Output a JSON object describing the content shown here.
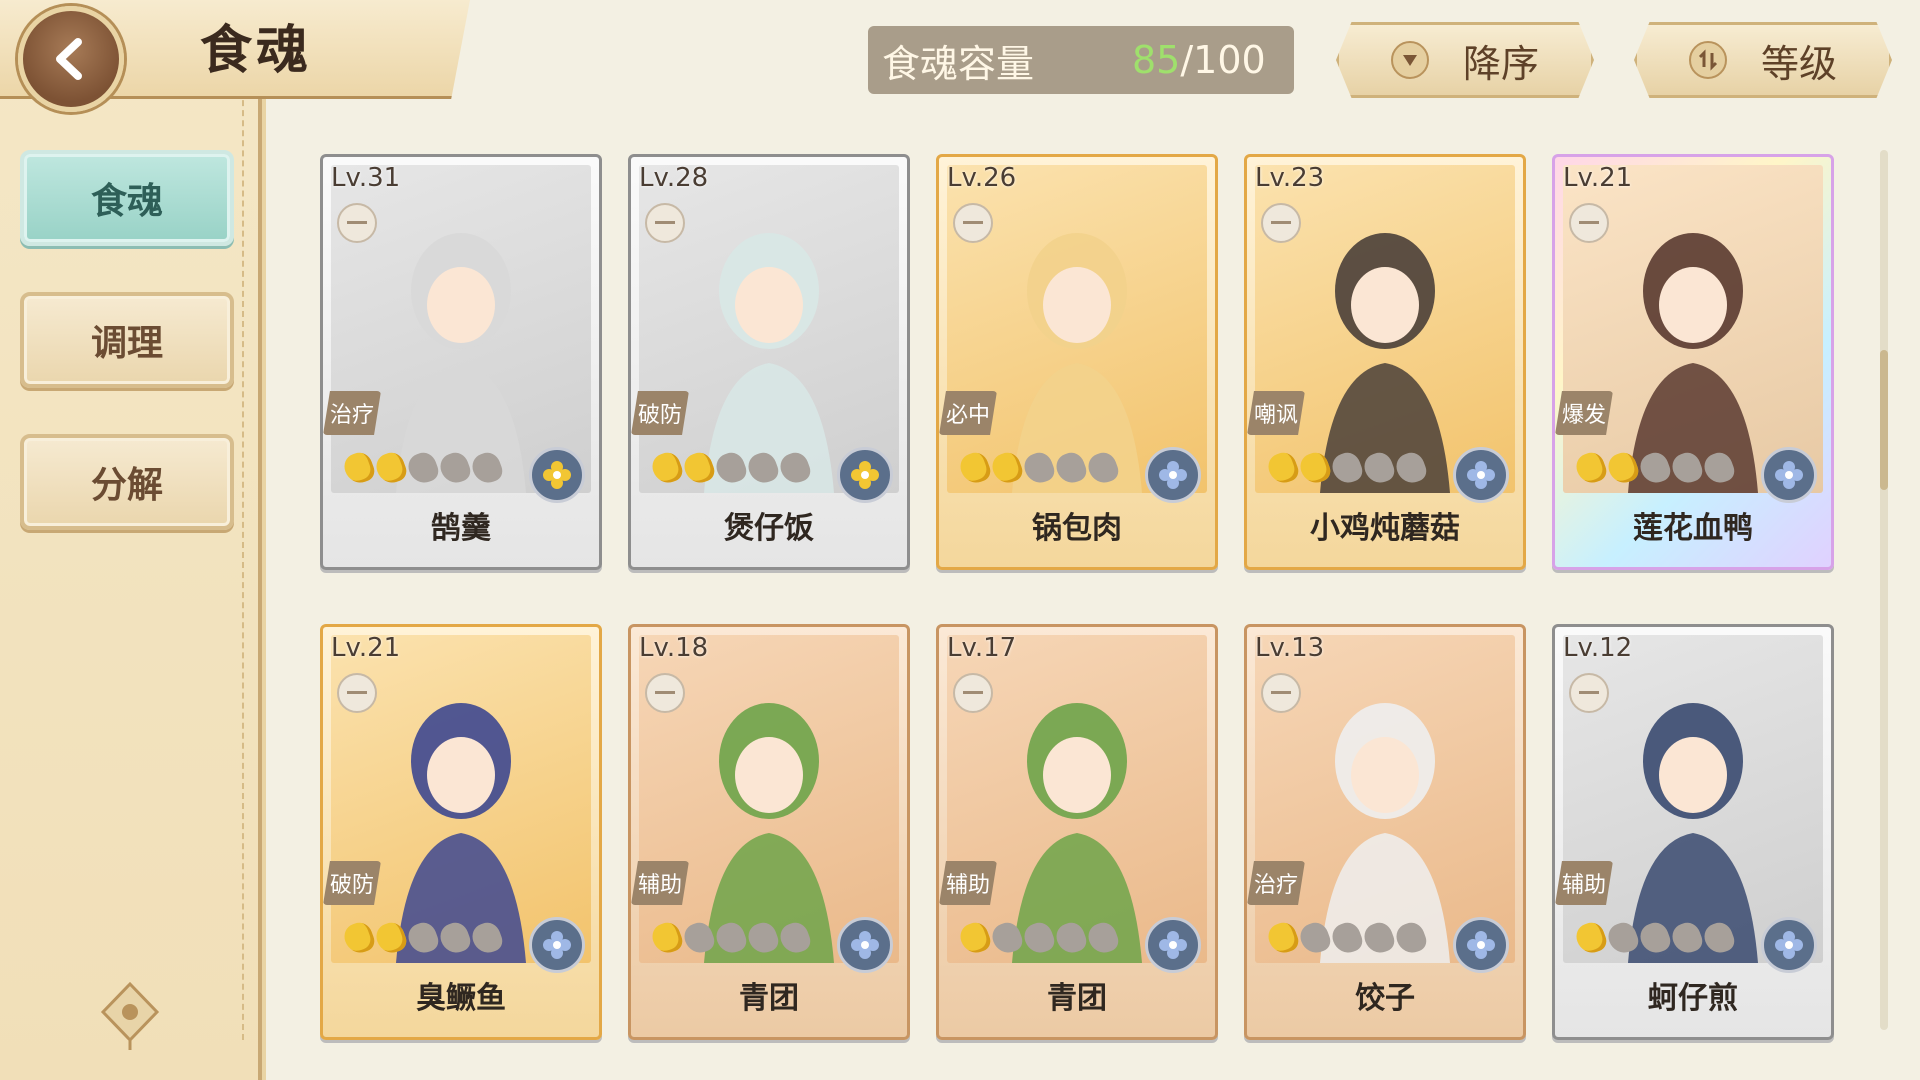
{
  "header": {
    "title": "食魂",
    "capacity_label": "食魂容量",
    "capacity_current": "85",
    "capacity_max": "/100",
    "sort_order_label": "降序",
    "sort_by_label": "等级"
  },
  "sidebar": {
    "items": [
      {
        "label": "食魂",
        "active": true
      },
      {
        "label": "调理",
        "active": false
      },
      {
        "label": "分解",
        "active": false
      }
    ]
  },
  "cards": [
    {
      "level": "Lv.31",
      "role": "治疗",
      "name": "鹄羹",
      "stars_on": 2,
      "stars_total": 5,
      "rarity": "silver",
      "element": "gold-flower-icon",
      "color": "#d8d8d8"
    },
    {
      "level": "Lv.28",
      "role": "破防",
      "name": "煲仔饭",
      "stars_on": 2,
      "stars_total": 5,
      "rarity": "silver",
      "element": "gold-flower-icon",
      "color": "#d8e8e6"
    },
    {
      "level": "Lv.26",
      "role": "必中",
      "name": "锅包肉",
      "stars_on": 2,
      "stars_total": 5,
      "rarity": "gold",
      "element": "blue-flower-icon",
      "color": "#f2d28c"
    },
    {
      "level": "Lv.23",
      "role": "嘲讽",
      "name": "小鸡炖蘑菇",
      "stars_on": 2,
      "stars_total": 5,
      "rarity": "gold",
      "element": "blue-flower-icon",
      "color": "#4a3f38"
    },
    {
      "level": "Lv.21",
      "role": "爆发",
      "name": "莲花血鸭",
      "stars_on": 2,
      "stars_total": 5,
      "rarity": "rainbow",
      "element": "blue-flower-icon",
      "color": "#5a3a30"
    },
    {
      "level": "Lv.21",
      "role": "破防",
      "name": "臭鳜鱼",
      "stars_on": 2,
      "stars_total": 5,
      "rarity": "gold",
      "element": "blue-flower-icon",
      "color": "#3e4890"
    },
    {
      "level": "Lv.18",
      "role": "辅助",
      "name": "青团",
      "stars_on": 1,
      "stars_total": 5,
      "rarity": "bronze",
      "element": "blue-flower-icon",
      "color": "#6ea44a"
    },
    {
      "level": "Lv.17",
      "role": "辅助",
      "name": "青团",
      "stars_on": 1,
      "stars_total": 5,
      "rarity": "bronze",
      "element": "blue-flower-icon",
      "color": "#6ea44a"
    },
    {
      "level": "Lv.13",
      "role": "治疗",
      "name": "饺子",
      "stars_on": 1,
      "stars_total": 5,
      "rarity": "bronze",
      "element": "blue-flower-icon",
      "color": "#eeeeee"
    },
    {
      "level": "Lv.12",
      "role": "辅助",
      "name": "蚵仔煎",
      "stars_on": 1,
      "stars_total": 5,
      "rarity": "silver",
      "element": "blue-flower-icon",
      "color": "#3a4a70"
    }
  ]
}
